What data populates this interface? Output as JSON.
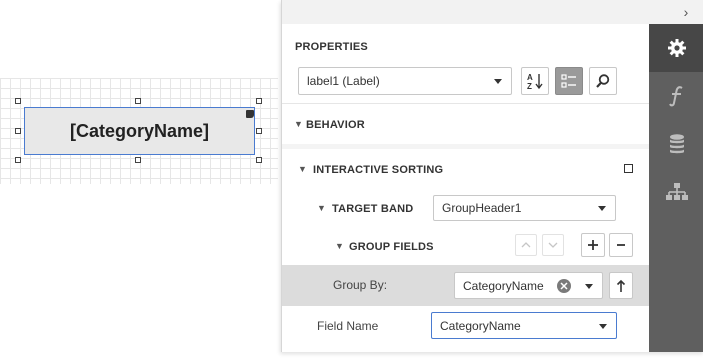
{
  "designer": {
    "label_text": "[CategoryName]"
  },
  "panel": {
    "collapse_glyph": "›",
    "properties_title": "PROPERTIES",
    "object_selector": "label1 (Label)",
    "sections": {
      "behavior": "BEHAVIOR",
      "interactive_sorting": "INTERACTIVE SORTING",
      "target_band": "TARGET BAND",
      "target_band_value": "GroupHeader1",
      "group_fields": "GROUP FIELDS",
      "group_by_label": "Group By:",
      "group_by_value": "CategoryName",
      "field_name_label": "Field Name",
      "field_name_value": "CategoryName"
    },
    "side_tabs": [
      "gear-icon",
      "function-icon",
      "database-icon",
      "hierarchy-icon"
    ],
    "colors": {
      "side_bg": "#5f5f5f",
      "side_active": "#474747",
      "selection_border": "#4a7bd0",
      "focus_border": "#4a7bd0"
    }
  }
}
